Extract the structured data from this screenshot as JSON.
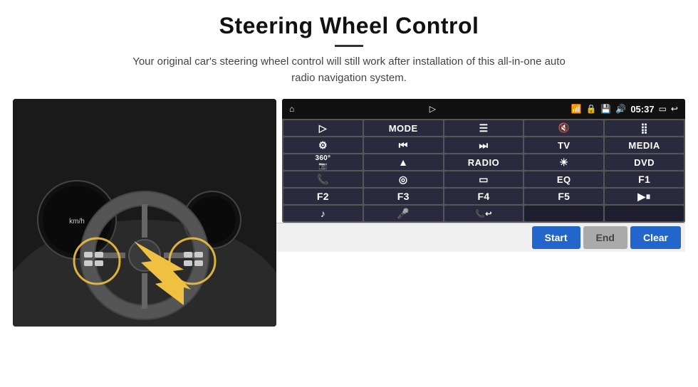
{
  "header": {
    "title": "Steering Wheel Control",
    "description": "Your original car's steering wheel control will still work after installation of this all-in-one auto radio navigation system."
  },
  "status_bar": {
    "home": "⌂",
    "time": "05:37",
    "icons": [
      "📶",
      "🔒",
      "💾",
      "🔊",
      "▭",
      "↩"
    ]
  },
  "buttons": [
    {
      "label": "▷",
      "row": 1,
      "col": 1,
      "type": "icon"
    },
    {
      "label": "MODE",
      "row": 1,
      "col": 2,
      "type": "text"
    },
    {
      "label": "☰",
      "row": 1,
      "col": 3,
      "type": "icon"
    },
    {
      "label": "🔇",
      "row": 1,
      "col": 4,
      "type": "icon"
    },
    {
      "label": "⣿",
      "row": 1,
      "col": 5,
      "type": "icon"
    },
    {
      "label": "⚙",
      "row": 2,
      "col": 1,
      "type": "icon"
    },
    {
      "label": "⏮",
      "row": 2,
      "col": 2,
      "type": "icon"
    },
    {
      "label": "⏭",
      "row": 2,
      "col": 3,
      "type": "icon"
    },
    {
      "label": "TV",
      "row": 2,
      "col": 4,
      "type": "text"
    },
    {
      "label": "MEDIA",
      "row": 2,
      "col": 5,
      "type": "text"
    },
    {
      "label": "360°",
      "row": 3,
      "col": 1,
      "type": "icon"
    },
    {
      "label": "▲",
      "row": 3,
      "col": 2,
      "type": "icon"
    },
    {
      "label": "RADIO",
      "row": 3,
      "col": 3,
      "type": "text"
    },
    {
      "label": "☀",
      "row": 3,
      "col": 4,
      "type": "icon"
    },
    {
      "label": "DVD",
      "row": 3,
      "col": 5,
      "type": "text"
    },
    {
      "label": "📞",
      "row": 4,
      "col": 1,
      "type": "icon"
    },
    {
      "label": "◎",
      "row": 4,
      "col": 2,
      "type": "icon"
    },
    {
      "label": "▭",
      "row": 4,
      "col": 3,
      "type": "icon"
    },
    {
      "label": "EQ",
      "row": 4,
      "col": 4,
      "type": "text"
    },
    {
      "label": "F1",
      "row": 4,
      "col": 5,
      "type": "text"
    },
    {
      "label": "F2",
      "row": 5,
      "col": 1,
      "type": "text"
    },
    {
      "label": "F3",
      "row": 5,
      "col": 2,
      "type": "text"
    },
    {
      "label": "F4",
      "row": 5,
      "col": 3,
      "type": "text"
    },
    {
      "label": "F5",
      "row": 5,
      "col": 4,
      "type": "text"
    },
    {
      "label": "▶⏸",
      "row": 5,
      "col": 5,
      "type": "icon"
    },
    {
      "label": "♪",
      "row": 6,
      "col": 1,
      "type": "icon"
    },
    {
      "label": "🎤",
      "row": 6,
      "col": 2,
      "type": "icon"
    },
    {
      "label": "📞/↩",
      "row": 6,
      "col": 3,
      "type": "icon"
    }
  ],
  "bottom_buttons": {
    "start": "Start",
    "end": "End",
    "clear": "Clear"
  }
}
